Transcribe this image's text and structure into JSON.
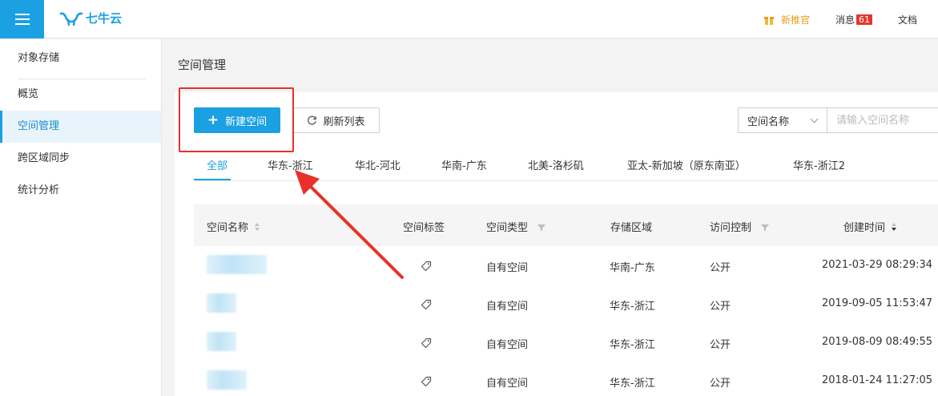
{
  "header": {
    "logo_text": "七牛云",
    "promo_label": "新推官",
    "messages_label": "消息",
    "messages_count": "61",
    "docs_label": "文档"
  },
  "sidebar": {
    "section_title": "对象存储",
    "items": [
      {
        "label": "概览"
      },
      {
        "label": "空间管理"
      },
      {
        "label": "跨区域同步"
      },
      {
        "label": "统计分析"
      }
    ],
    "active_index": 1
  },
  "main": {
    "page_title": "空间管理",
    "new_button_label": "新建空间",
    "refresh_button_label": "刷新列表",
    "search_select_value": "空间名称",
    "search_placeholder": "请输入空间名称",
    "tabs": [
      {
        "label": "全部"
      },
      {
        "label": "华东-浙江"
      },
      {
        "label": "华北-河北"
      },
      {
        "label": "华南-广东"
      },
      {
        "label": "北美-洛杉矶"
      },
      {
        "label": "亚太-新加坡（原东南亚）"
      },
      {
        "label": "华东-浙江2"
      }
    ],
    "active_tab_index": 0,
    "table": {
      "columns": [
        "空间名称",
        "空间标签",
        "空间类型",
        "存储区域",
        "访问控制",
        "创建时间"
      ],
      "rows": [
        {
          "name": "",
          "type": "自有空间",
          "region": "华南-广东",
          "access": "公开",
          "created": "2021-03-29 08:29:34"
        },
        {
          "name": "",
          "type": "自有空间",
          "region": "华东-浙江",
          "access": "公开",
          "created": "2019-09-05 11:53:47"
        },
        {
          "name": "",
          "type": "自有空间",
          "region": "华东-浙江",
          "access": "公开",
          "created": "2019-08-09 08:49:55"
        },
        {
          "name": "",
          "type": "自有空间",
          "region": "华东-浙江",
          "access": "公开",
          "created": "2018-01-24 11:27:05"
        }
      ]
    }
  },
  "colors": {
    "brand": "#1ba0e1",
    "promo": "#e3a11d",
    "badge": "#e2372b",
    "annotation": "#e8312a"
  },
  "icons": [
    "menu-icon",
    "qiniu-logo",
    "gift-icon",
    "plus-icon",
    "refresh-icon",
    "chevron-down-icon",
    "sort-icon",
    "filter-icon",
    "tag-icon"
  ]
}
